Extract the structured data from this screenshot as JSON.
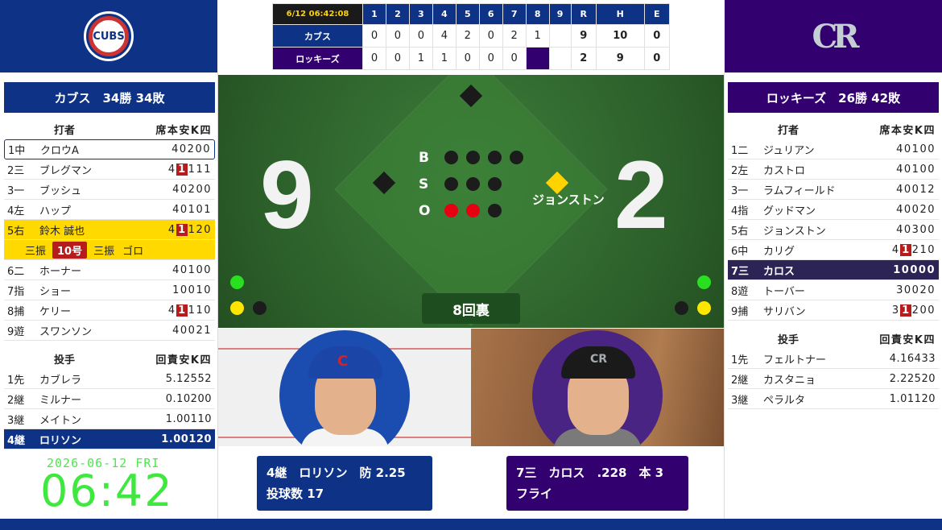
{
  "home": {
    "team_bar": "カブス　34勝 34敗",
    "logo_text": "CUBS",
    "color": "#0e3386",
    "batter_header": {
      "label": "打者",
      "stats": "席本安K四"
    },
    "batters": [
      {
        "num": "1中",
        "name": "クロウA",
        "stats": "40200"
      },
      {
        "num": "2三",
        "name": "ブレグマン",
        "pre": "4",
        "hit": "1",
        "post": "111"
      },
      {
        "num": "3一",
        "name": "ブッシュ",
        "stats": "40200"
      },
      {
        "num": "4左",
        "name": "ハップ",
        "stats": "40101"
      },
      {
        "num": "5右",
        "name": "鈴木 誠也",
        "pre": "4",
        "hit": "1",
        "post": "120"
      },
      {
        "num": "6二",
        "name": "ホーナー",
        "stats": "40100"
      },
      {
        "num": "7指",
        "name": "ショー",
        "stats": "10010"
      },
      {
        "num": "8捕",
        "name": "ケリー",
        "pre": "4",
        "hit": "1",
        "post": "110"
      },
      {
        "num": "9遊",
        "name": "スワンソン",
        "stats": "40021"
      }
    ],
    "suzuki_sub": {
      "a": "三振",
      "hr": "10号",
      "b": "三振",
      "c": "ゴロ"
    },
    "pitcher_header": {
      "label": "投手",
      "stats": "回責安K四"
    },
    "pitchers": [
      {
        "num": "1先",
        "name": "カブレラ",
        "stats": "5.12552"
      },
      {
        "num": "2継",
        "name": "ミルナー",
        "stats": "0.10200"
      },
      {
        "num": "3継",
        "name": "メイトン",
        "stats": "1.00110"
      },
      {
        "num": "4継",
        "name": "ロリソン",
        "stats": "1.00120"
      }
    ]
  },
  "away": {
    "team_bar": "ロッキーズ　26勝 42敗",
    "logo_text": "CR",
    "color": "#33006f",
    "batter_header": {
      "label": "打者",
      "stats": "席本安K四"
    },
    "batters": [
      {
        "num": "1二",
        "name": "ジュリアン",
        "stats": "40100"
      },
      {
        "num": "2左",
        "name": "カストロ",
        "stats": "40100"
      },
      {
        "num": "3一",
        "name": "ラムフィールド",
        "stats": "40012"
      },
      {
        "num": "4指",
        "name": "グッドマン",
        "stats": "40020"
      },
      {
        "num": "5右",
        "name": "ジョンストン",
        "stats": "40300"
      },
      {
        "num": "6中",
        "name": "カリグ",
        "pre": "4",
        "hit": "1",
        "post": "210"
      },
      {
        "num": "7三",
        "name": "カロス",
        "stats": "10000"
      },
      {
        "num": "8遊",
        "name": "トーバー",
        "stats": "30020"
      },
      {
        "num": "9捕",
        "name": "サリバン",
        "pre": "3",
        "hit": "1",
        "post": "200"
      }
    ],
    "pitcher_header": {
      "label": "投手",
      "stats": "回責安K四"
    },
    "pitchers": [
      {
        "num": "1先",
        "name": "フェルトナー",
        "stats": "4.16433"
      },
      {
        "num": "2継",
        "name": "カスタニョ",
        "stats": "2.22520"
      },
      {
        "num": "3継",
        "name": "ペラルタ",
        "stats": "1.01120"
      }
    ]
  },
  "linescore": {
    "datetime": "6/12 06:42:08",
    "innings": [
      "1",
      "2",
      "3",
      "4",
      "5",
      "6",
      "7",
      "8",
      "9",
      "R",
      "H",
      "E"
    ],
    "rows": [
      {
        "team": "カブス",
        "scores": [
          "0",
          "0",
          "0",
          "4",
          "2",
          "0",
          "2",
          "1",
          "",
          "9",
          "10",
          "0"
        ]
      },
      {
        "team": "ロッキーズ",
        "scores": [
          "0",
          "0",
          "1",
          "1",
          "0",
          "0",
          "0",
          "",
          "",
          "2",
          "9",
          "0"
        ]
      }
    ]
  },
  "field": {
    "home_score": "9",
    "away_score": "2",
    "bso": {
      "b": "B",
      "s": "S",
      "o": "O",
      "balls": 0,
      "strikes": 0,
      "outs": 2
    },
    "runner_first": "ジョンストン",
    "inning": "8回裏"
  },
  "pitcher_info": {
    "line1": "4継　ロリソン　防 2.25",
    "line2": "投球数 17"
  },
  "batter_info": {
    "line1": "7三　カロス　.228　本 3",
    "line2": "フライ"
  },
  "clock": {
    "date": "2026-06-12 FRI",
    "time": "06:42"
  }
}
